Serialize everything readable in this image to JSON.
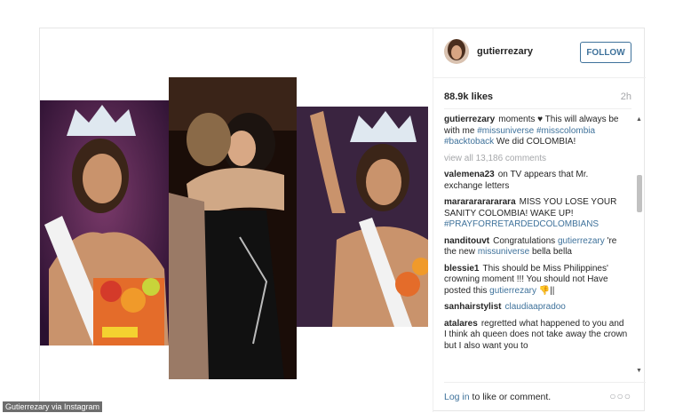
{
  "post": {
    "username": "gutierrezary",
    "follow_label": "FOLLOW",
    "likes": "88.9k likes",
    "time": "2h",
    "caption": {
      "user": "gutierrezary",
      "text1": "moments ♥ This will always be with me ",
      "tag1": "#missuniverse",
      "tag2": "#misscolombia",
      "tag3": "#backtoback",
      "text2": " We did COLOMBIA!"
    },
    "view_all": "view all 13,186 comments",
    "comments": [
      {
        "user": "valemena23",
        "text": "on TV appears that Mr. exchange letters"
      },
      {
        "user": "mararararararara",
        "text": "MISS YOU LOSE YOUR SANITY COLOMBIA! WAKE UP! ",
        "tag": "#PRAYFORRETARDEDCOLOMBIANS"
      },
      {
        "user": "nanditouvt",
        "text": "Congratulations ",
        "mention": "gutierrezary",
        "text2": " 're the new ",
        "link": "missuniverse",
        "text3": " bella bella"
      },
      {
        "user": "blessie1",
        "text": "This should be Miss Philippines' crowning moment !!! You should not Have posted this ",
        "mention": "gutierrezary",
        "text2": " 👎||"
      },
      {
        "user": "sanhairstylist",
        "mention": "claudiaapradoo"
      },
      {
        "user": "atalares",
        "text": "regretted what happened to you and I think ah queen does not take away the crown but I also want you to"
      }
    ],
    "footer": {
      "login_link": "Log in",
      "login_rest": " to like or comment.",
      "more": "○○○"
    }
  },
  "credit": "Gutierrezary via Instagram",
  "colors": {
    "link": "#3f729b",
    "muted": "#a5a7aa",
    "text": "#262626"
  }
}
